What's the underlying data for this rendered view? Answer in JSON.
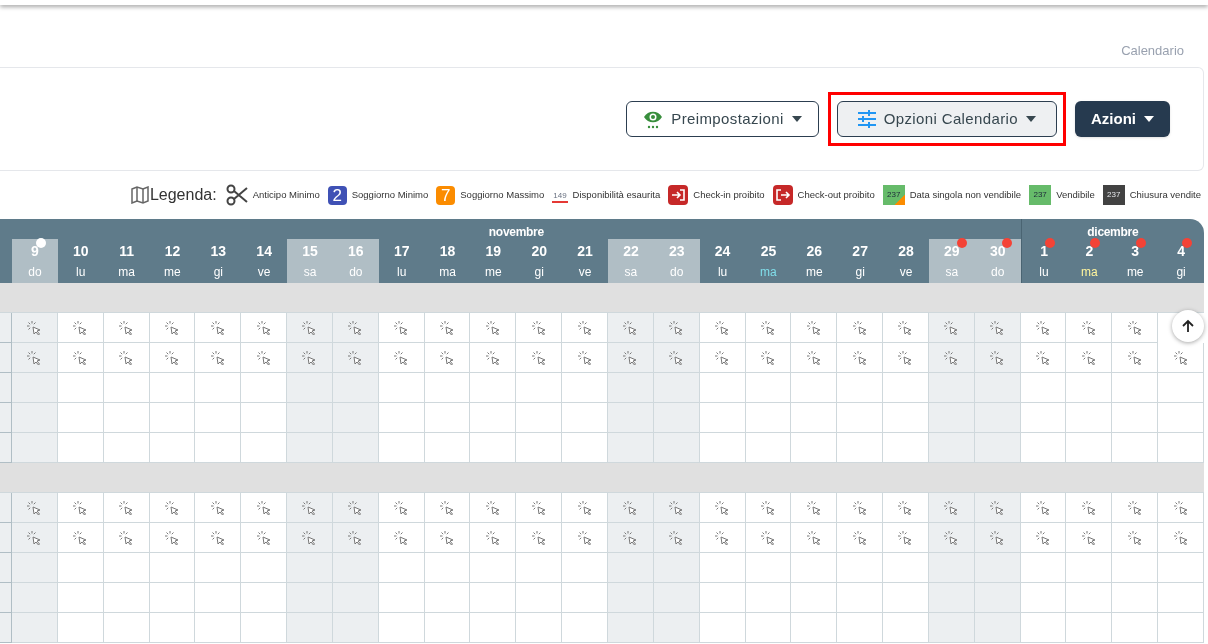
{
  "breadcrumb": "Calendario",
  "toolbar": {
    "buttons": [
      {
        "kind": "eye",
        "label": "Preimpostazioni",
        "highlighted": false
      },
      {
        "kind": "sliders",
        "label": "Opzioni Calendario",
        "highlighted": true
      },
      {
        "kind": "dark",
        "label": "Azioni",
        "highlighted": false
      }
    ]
  },
  "legend": {
    "title": "Legenda:",
    "items": [
      {
        "kind": "scissors",
        "label": "Anticipo Minimo"
      },
      {
        "kind": "number",
        "sample": "2",
        "color": "#3f51b5",
        "label": "Soggiorno Minimo"
      },
      {
        "kind": "number",
        "sample": "7",
        "color": "#fb8c00",
        "label": "Soggiorno Massimo"
      },
      {
        "kind": "underline",
        "sample": "149",
        "label": "Disponibilità esaurita"
      },
      {
        "kind": "checkin",
        "label": "Check-in proibito"
      },
      {
        "kind": "checkout",
        "label": "Check-out proibito"
      },
      {
        "kind": "swatch",
        "sample": "237",
        "color": "#66bb6a",
        "corner": true,
        "label": "Data singola non vendibile"
      },
      {
        "kind": "swatch",
        "sample": "237",
        "color": "#66bb6a",
        "corner": false,
        "label": "Vendibile"
      },
      {
        "kind": "swatch",
        "sample": "237",
        "color": "#424242",
        "corner": false,
        "label": "Chiusura vendite"
      }
    ]
  },
  "calendar": {
    "months": [
      {
        "name": "novembre",
        "days": [
          {
            "day": "9",
            "weekday": {
              "text": "do"
            },
            "weekend": true,
            "dot": {
              "color": "#ffffff"
            }
          },
          {
            "day": "10",
            "weekday": {
              "text": "lu"
            },
            "weekend": false
          },
          {
            "day": "11",
            "weekday": {
              "text": "ma"
            },
            "weekend": false
          },
          {
            "day": "12",
            "weekday": {
              "text": "me"
            },
            "weekend": false
          },
          {
            "day": "13",
            "weekday": {
              "text": "gi"
            },
            "weekend": false
          },
          {
            "day": "14",
            "weekday": {
              "text": "ve"
            },
            "weekend": false
          },
          {
            "day": "15",
            "weekday": {
              "text": "sa"
            },
            "weekend": true
          },
          {
            "day": "16",
            "weekday": {
              "text": "do"
            },
            "weekend": true
          },
          {
            "day": "17",
            "weekday": {
              "text": "lu"
            },
            "weekend": false
          },
          {
            "day": "18",
            "weekday": {
              "text": "ma"
            },
            "weekend": false
          },
          {
            "day": "19",
            "weekday": {
              "text": "me"
            },
            "weekend": false
          },
          {
            "day": "20",
            "weekday": {
              "text": "gi"
            },
            "weekend": false
          },
          {
            "day": "21",
            "weekday": {
              "text": "ve"
            },
            "weekend": false
          },
          {
            "day": "22",
            "weekday": {
              "text": "sa"
            },
            "weekend": true
          },
          {
            "day": "23",
            "weekday": {
              "text": "do"
            },
            "weekend": true
          },
          {
            "day": "24",
            "weekday": {
              "text": "lu"
            },
            "weekend": false
          },
          {
            "day": "25",
            "weekday": {
              "text": "ma",
              "color": "#80deea"
            },
            "weekend": false
          },
          {
            "day": "26",
            "weekday": {
              "text": "me"
            },
            "weekend": false
          },
          {
            "day": "27",
            "weekday": {
              "text": "gi"
            },
            "weekend": false
          },
          {
            "day": "28",
            "weekday": {
              "text": "ve"
            },
            "weekend": false
          },
          {
            "day": "29",
            "weekday": {
              "text": "sa"
            },
            "weekend": true,
            "dot": {
              "color": "#f44336"
            }
          },
          {
            "day": "30",
            "weekday": {
              "text": "do"
            },
            "weekend": true,
            "dot": {
              "color": "#f44336"
            }
          }
        ]
      },
      {
        "name": "dicembre",
        "days": [
          {
            "day": "1",
            "weekday": {
              "text": "lu"
            },
            "weekend": false,
            "dot": {
              "color": "#f44336"
            }
          },
          {
            "day": "2",
            "weekday": {
              "text": "ma",
              "color": "#fff59d"
            },
            "weekend": false,
            "dot": {
              "color": "#f44336"
            }
          },
          {
            "day": "3",
            "weekday": {
              "text": "me"
            },
            "weekend": false,
            "dot": {
              "color": "#f44336"
            }
          },
          {
            "day": "4",
            "weekday": {
              "text": "gi"
            },
            "weekend": false,
            "dot": {
              "color": "#f44336"
            }
          }
        ]
      }
    ],
    "rows": [
      {
        "kind": "band"
      },
      {
        "kind": "icons"
      },
      {
        "kind": "icons"
      },
      {
        "kind": "empty"
      },
      {
        "kind": "empty"
      },
      {
        "kind": "empty"
      },
      {
        "kind": "band"
      },
      {
        "kind": "icons"
      },
      {
        "kind": "icons"
      },
      {
        "kind": "empty"
      },
      {
        "kind": "empty"
      },
      {
        "kind": "empty"
      }
    ]
  }
}
